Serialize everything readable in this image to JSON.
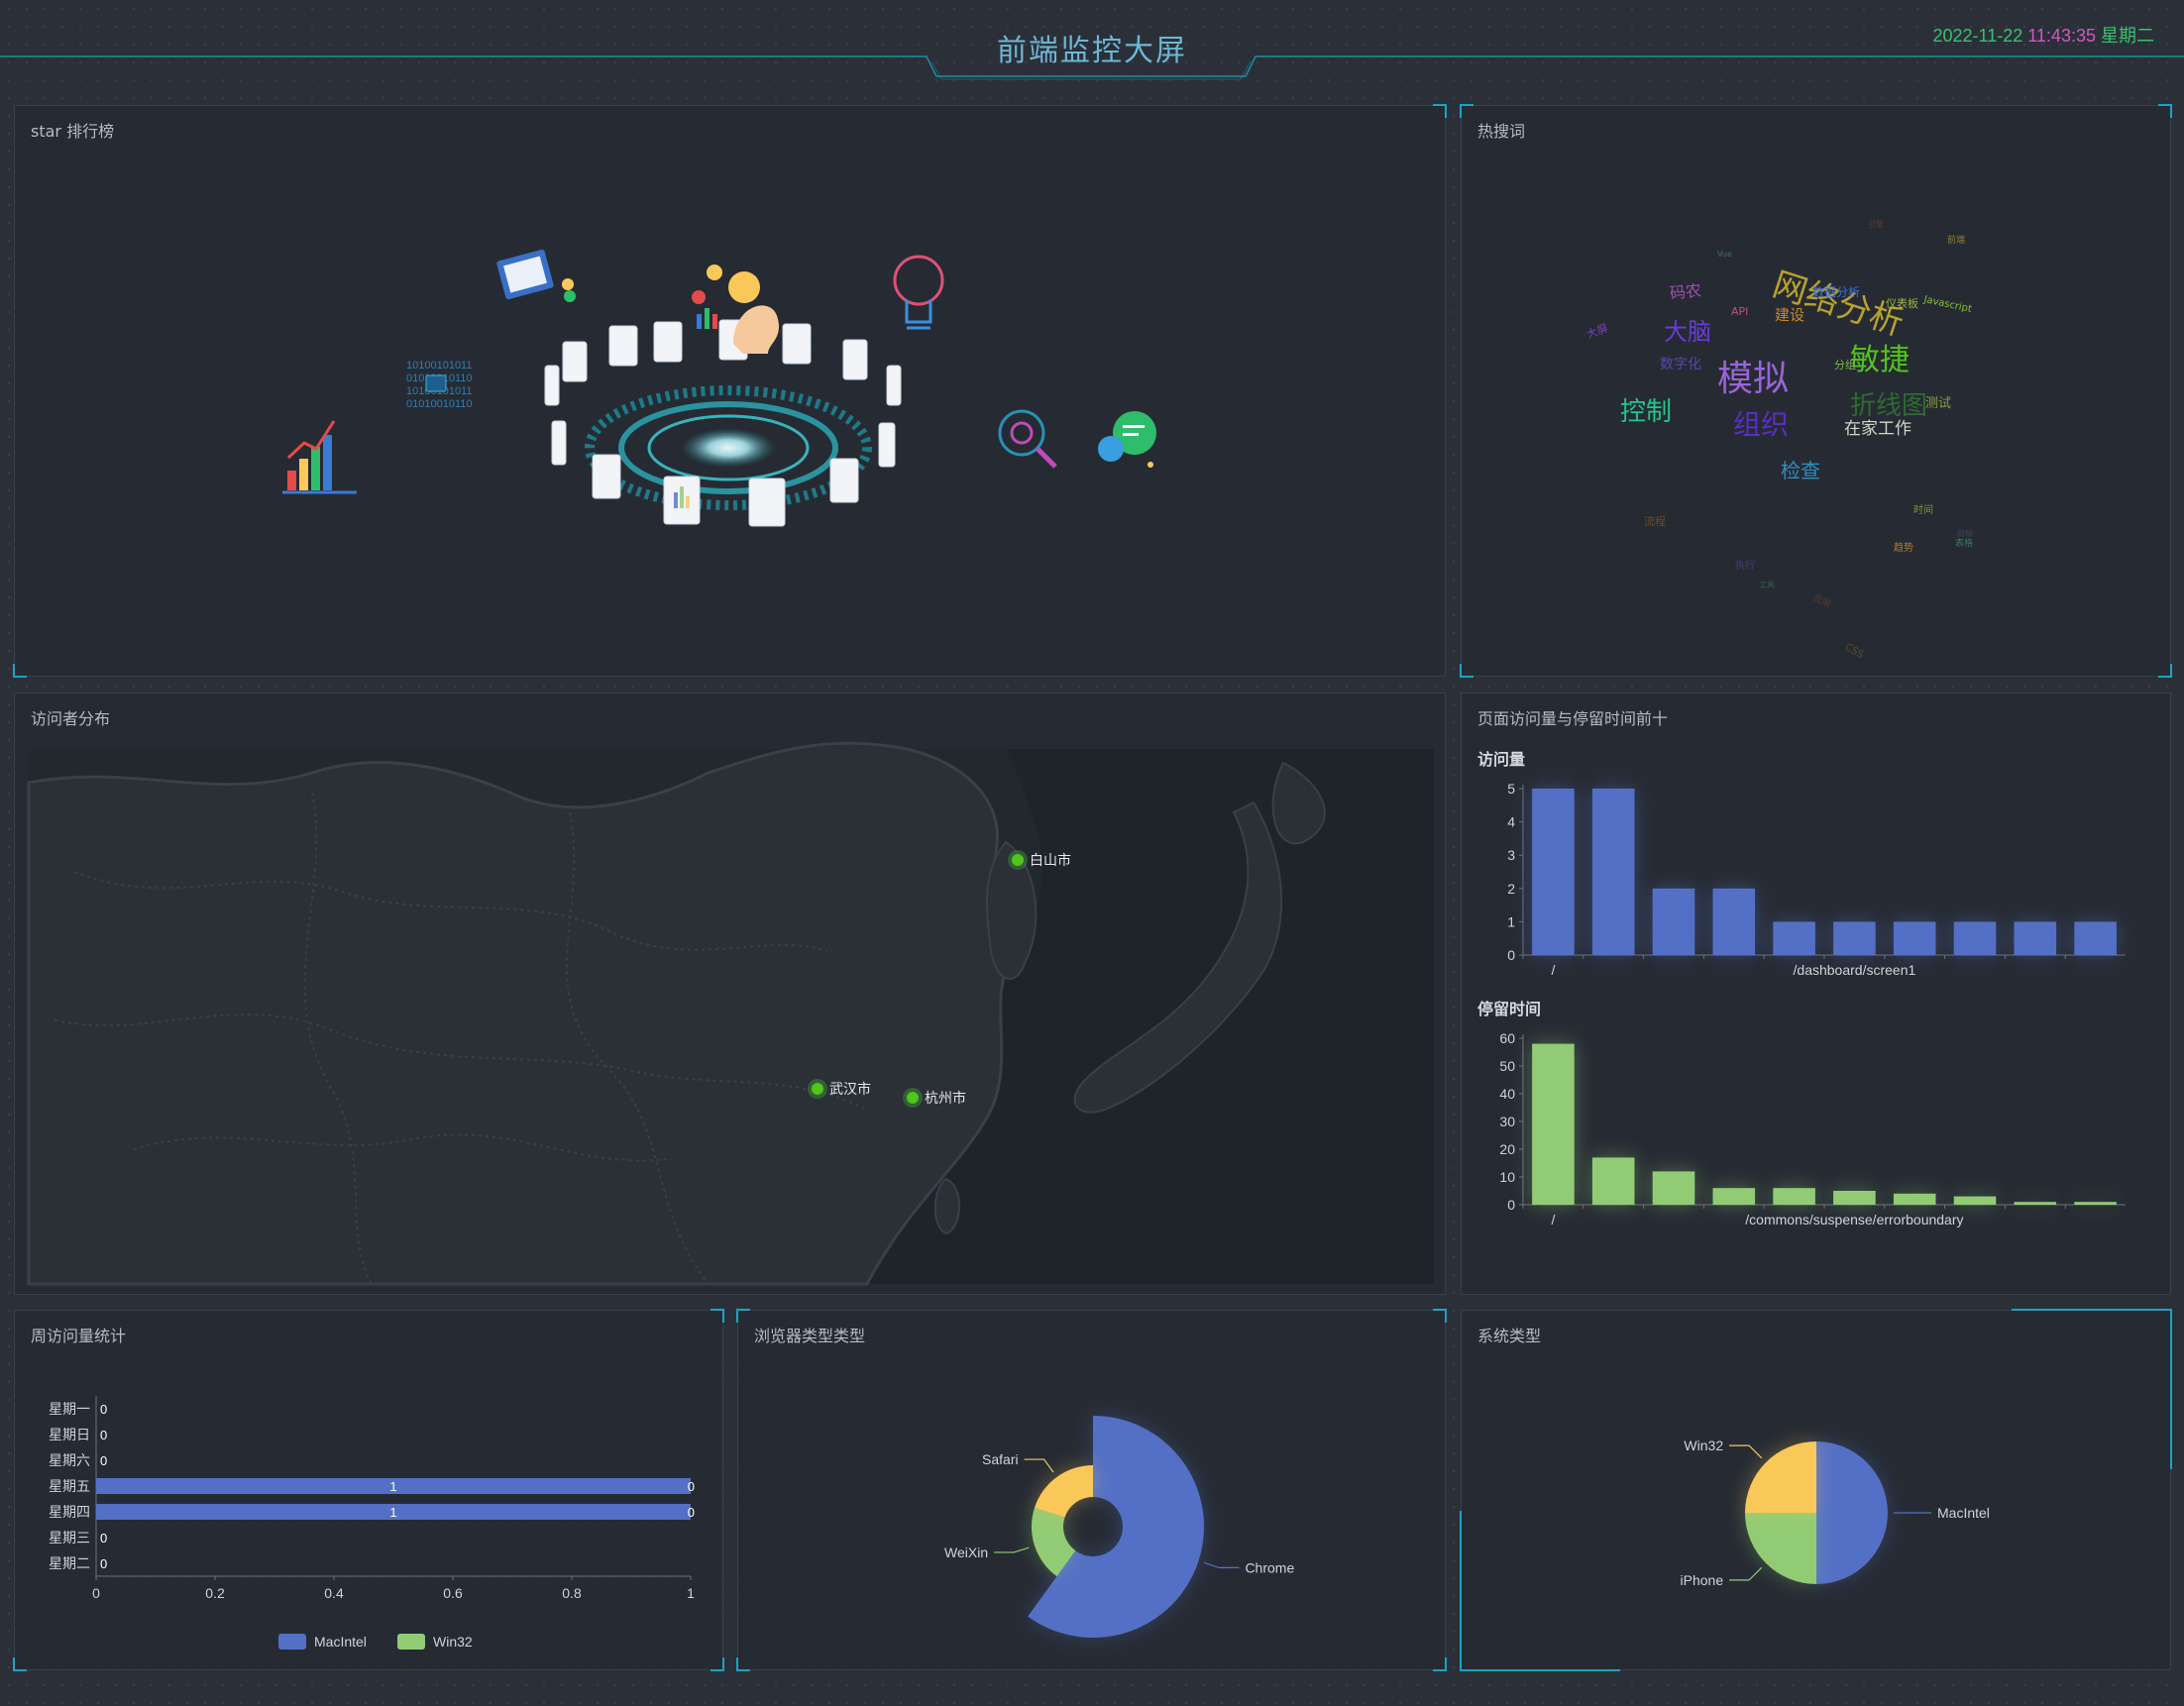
{
  "header": {
    "title": "前端监控大屏",
    "date": "2022-11-22",
    "time": "11:43:35",
    "weekday": "星期二"
  },
  "panels": {
    "star_rank": {
      "title": "star 排行榜"
    },
    "hot_words": {
      "title": "热搜词",
      "words": [
        {
          "text": "网络分析",
          "color": "#b8a22e"
        },
        {
          "text": "模拟",
          "color": "#9a63d9"
        },
        {
          "text": "敏捷",
          "color": "#52c41a"
        },
        {
          "text": "控制",
          "color": "#22c58b"
        },
        {
          "text": "组织",
          "color": "#5b2cc9"
        },
        {
          "text": "大脑",
          "color": "#6a3bd6"
        },
        {
          "text": "折线图",
          "color": "#2e6b33"
        },
        {
          "text": "在家工作",
          "color": "#cfd6c8"
        },
        {
          "text": "检查",
          "color": "#2f8fc0"
        },
        {
          "text": "码农",
          "color": "#a04fb0"
        },
        {
          "text": "数字化",
          "color": "#5a44b0"
        },
        {
          "text": "数据分析",
          "color": "#3d6fd1"
        },
        {
          "text": "仪表板",
          "color": "#9db340"
        },
        {
          "text": "Javascript",
          "color": "#86c232"
        },
        {
          "text": "API",
          "color": "#c04b8a"
        },
        {
          "text": "建设",
          "color": "#c88a2b"
        },
        {
          "text": "分组",
          "color": "#7db84a"
        },
        {
          "text": "测试",
          "color": "#8a9f3a"
        },
        {
          "text": "大屏",
          "color": "#7a3fc0"
        },
        {
          "text": "流程",
          "color": "#6b4b2a"
        },
        {
          "text": "时间",
          "color": "#7a9a2a"
        },
        {
          "text": "趋势",
          "color": "#b37d2a"
        },
        {
          "text": "前端",
          "color": "#8a7a3a"
        },
        {
          "text": "执行",
          "color": "#4a3a7a"
        },
        {
          "text": "CSS",
          "color": "#5a4a2a"
        },
        {
          "text": "表格",
          "color": "#3a7a5a"
        },
        {
          "text": "应用",
          "color": "#5a3a2a"
        },
        {
          "text": "工具",
          "color": "#3a5a4a"
        },
        {
          "text": "Vue",
          "color": "#3a6a7a"
        },
        {
          "text": "引擎",
          "color": "#5a3a3a"
        },
        {
          "text": "目标",
          "color": "#3a4a5a"
        }
      ]
    },
    "visitor_map": {
      "title": "访问者分布",
      "cities": [
        "白山市",
        "武汉市",
        "杭州市"
      ]
    },
    "top_pages": {
      "title": "页面访问量与停留时间前十",
      "visits_title": "访问量",
      "stay_title": "停留时间"
    },
    "weekly": {
      "title": "周访问量统计"
    },
    "browser": {
      "title": "浏览器类型类型"
    },
    "system": {
      "title": "系统类型"
    }
  },
  "chart_data": [
    {
      "id": "visits",
      "type": "bar",
      "title": "访问量",
      "categories": [
        "/",
        "",
        "",
        "",
        "",
        "/dashboard/screen1",
        "",
        "",
        "",
        ""
      ],
      "values": [
        5,
        5,
        2,
        2,
        1,
        1,
        1,
        1,
        1,
        1
      ],
      "ylim": [
        0,
        5
      ],
      "yticks": [
        0,
        1,
        2,
        3,
        4,
        5
      ],
      "color": "#5470c6"
    },
    {
      "id": "stay",
      "type": "bar",
      "title": "停留时间",
      "categories": [
        "/",
        "",
        "",
        "",
        "",
        "/commons/suspense/errorboundary",
        "",
        "",
        "",
        ""
      ],
      "values": [
        58,
        17,
        12,
        6,
        6,
        5,
        4,
        3,
        1,
        1
      ],
      "ylim": [
        0,
        60
      ],
      "yticks": [
        0,
        10,
        20,
        30,
        40,
        50,
        60
      ],
      "color": "#91cc75"
    },
    {
      "id": "weekly",
      "type": "bar",
      "orientation": "horizontal",
      "categories": [
        "星期一",
        "星期日",
        "星期六",
        "星期五",
        "星期四",
        "星期三",
        "星期二"
      ],
      "series": [
        {
          "name": "MacIntel",
          "values": [
            0,
            0,
            0,
            1,
            1,
            0,
            0
          ],
          "color": "#5470c6"
        },
        {
          "name": "Win32",
          "values": [
            0,
            0,
            0,
            0,
            0,
            0,
            0
          ],
          "color": "#91cc75"
        }
      ],
      "xlim": [
        0,
        1
      ],
      "xticks": [
        "0",
        "0.2",
        "0.4",
        "0.6",
        "0.8",
        "1"
      ]
    },
    {
      "id": "browser",
      "type": "pie",
      "style": "rose-donut",
      "labels": [
        "Chrome",
        "WeiXin",
        "Safari"
      ],
      "values": [
        3,
        1,
        1
      ],
      "colors": [
        "#5470c6",
        "#91cc75",
        "#fac858"
      ]
    },
    {
      "id": "system",
      "type": "pie",
      "labels": [
        "MacIntel",
        "iPhone",
        "Win32"
      ],
      "values": [
        2,
        1,
        1
      ],
      "colors": [
        "#5470c6",
        "#91cc75",
        "#fac858"
      ]
    }
  ]
}
